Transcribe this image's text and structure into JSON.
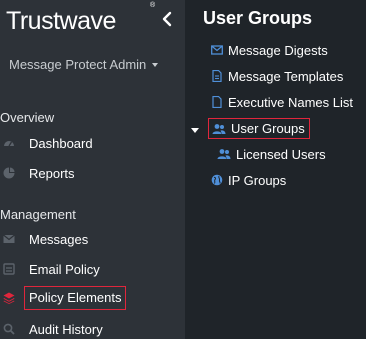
{
  "brand": {
    "name": "Trustwave",
    "mark": "®"
  },
  "account": {
    "label": "Message Protect Admin"
  },
  "sidebar": {
    "sections": [
      {
        "label": "Overview"
      },
      {
        "label": "Management"
      }
    ],
    "items": [
      {
        "label": "Dashboard",
        "icon": "speedometer-icon"
      },
      {
        "label": "Reports",
        "icon": "pie-chart-icon"
      },
      {
        "label": "Messages",
        "icon": "envelope-icon"
      },
      {
        "label": "Email Policy",
        "icon": "policy-doc-icon"
      },
      {
        "label": "Policy Elements",
        "icon": "layers-icon",
        "active": true
      },
      {
        "label": "Audit History",
        "icon": "magnifier-icon"
      }
    ]
  },
  "panel": {
    "title": "User Groups",
    "tree": [
      {
        "label": "Message Digests",
        "icon": "envelope-icon"
      },
      {
        "label": "Message Templates",
        "icon": "document-icon"
      },
      {
        "label": "Executive Names List",
        "icon": "document-outline-icon"
      },
      {
        "label": "User Groups",
        "icon": "users-icon",
        "selected": true,
        "expanded": true
      },
      {
        "label": "Licensed Users",
        "icon": "users-icon"
      },
      {
        "label": "IP Groups",
        "icon": "globe-icon"
      }
    ]
  },
  "colors": {
    "sidebar_bg": "#2d3238",
    "panel_bg": "#1f2429",
    "highlight_border": "#e0263c",
    "icon_blue": "#4f8fd8",
    "icon_gray": "#5c636b",
    "policy_red": "#e0263c"
  }
}
